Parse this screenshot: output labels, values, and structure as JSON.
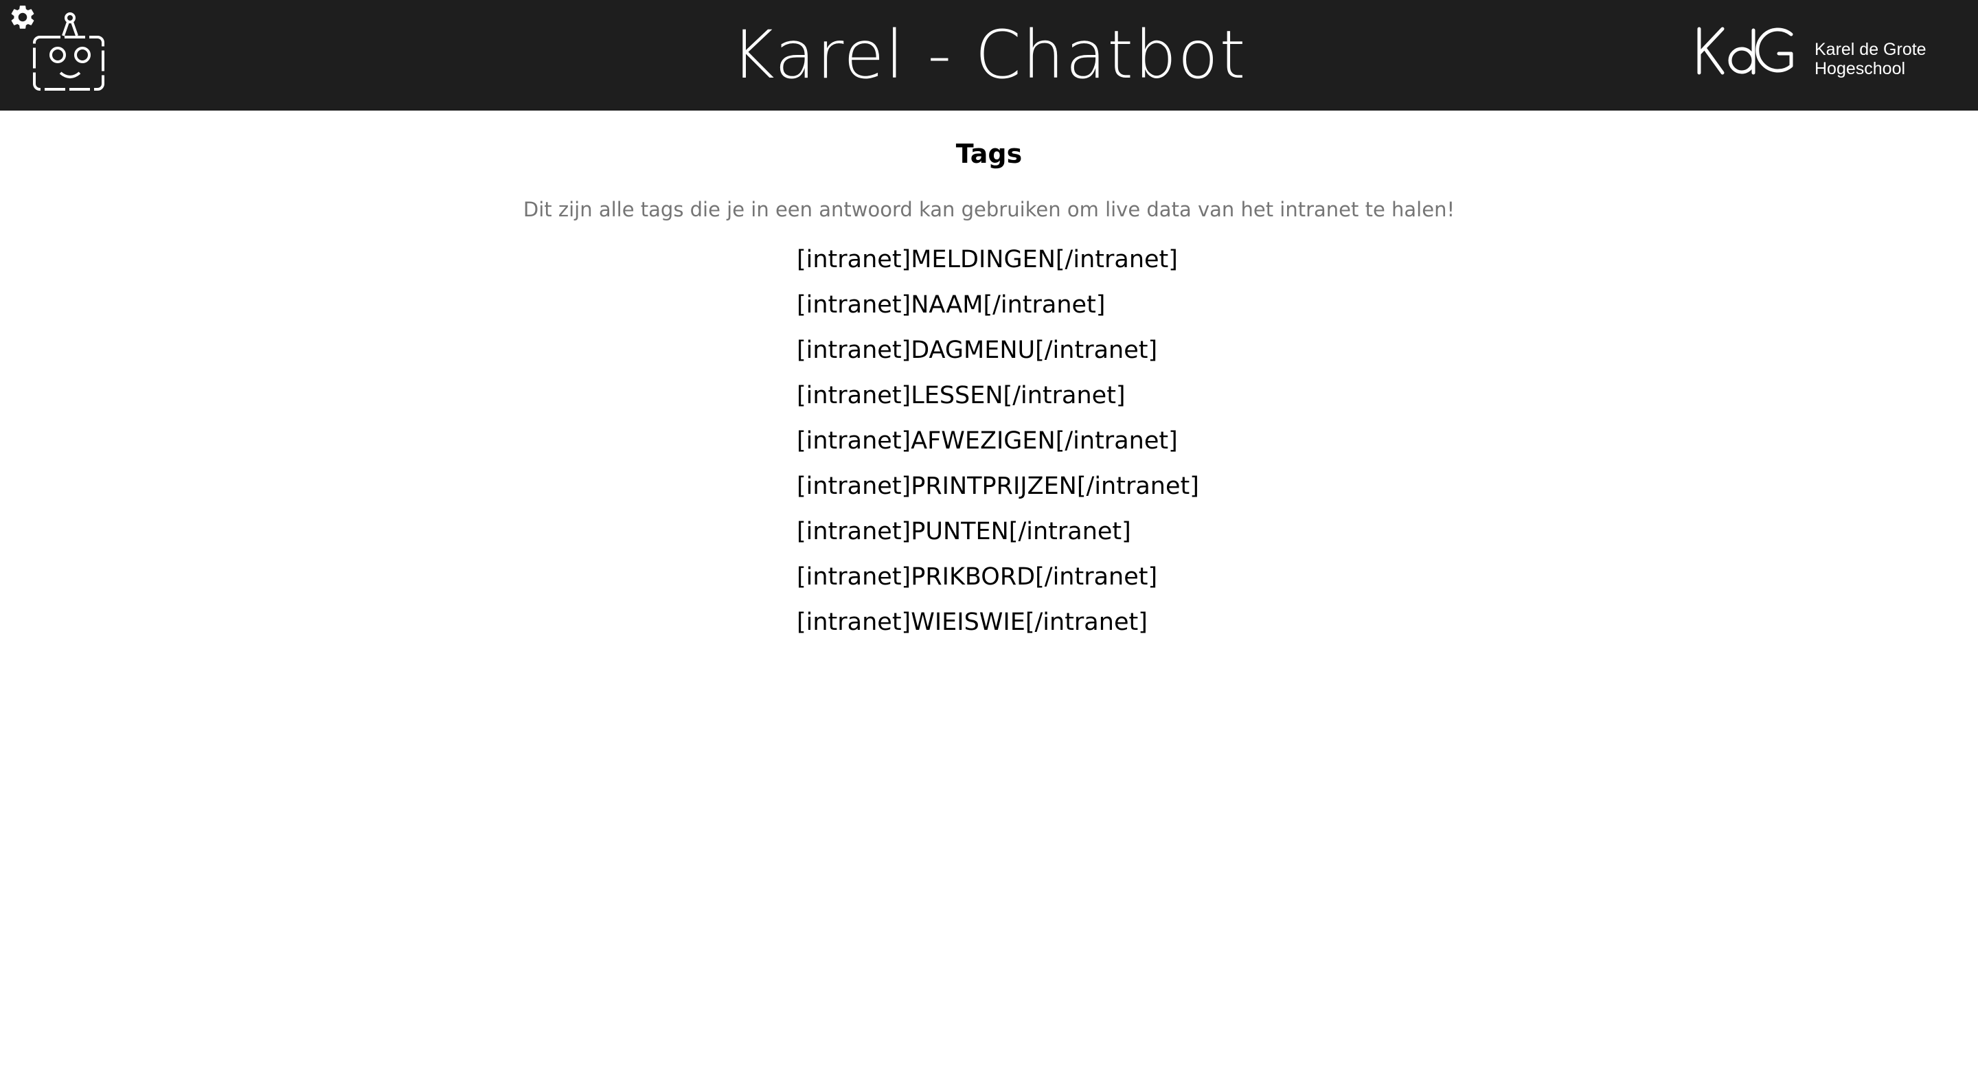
{
  "header": {
    "title": "Karel - Chatbot",
    "logo_mark": "KdG",
    "logo_line1": "Karel de Grote",
    "logo_line2": "Hogeschool",
    "settings_icon": "gear-icon",
    "bot_icon": "robot-icon",
    "background": "#1e1e1e"
  },
  "main": {
    "title": "Tags",
    "description": "Dit zijn alle tags die je in een antwoord kan gebruiken om live data van het intranet te halen!",
    "tags": [
      "[intranet]MELDINGEN[/intranet]",
      "[intranet]NAAM[/intranet]",
      "[intranet]DAGMENU[/intranet]",
      "[intranet]LESSEN[/intranet]",
      "[intranet]AFWEZIGEN[/intranet]",
      "[intranet]PRINTPRIJZEN[/intranet]",
      "[intranet]PUNTEN[/intranet]",
      "[intranet]PRIKBORD[/intranet]",
      "[intranet]WIEISWIE[/intranet]"
    ]
  }
}
